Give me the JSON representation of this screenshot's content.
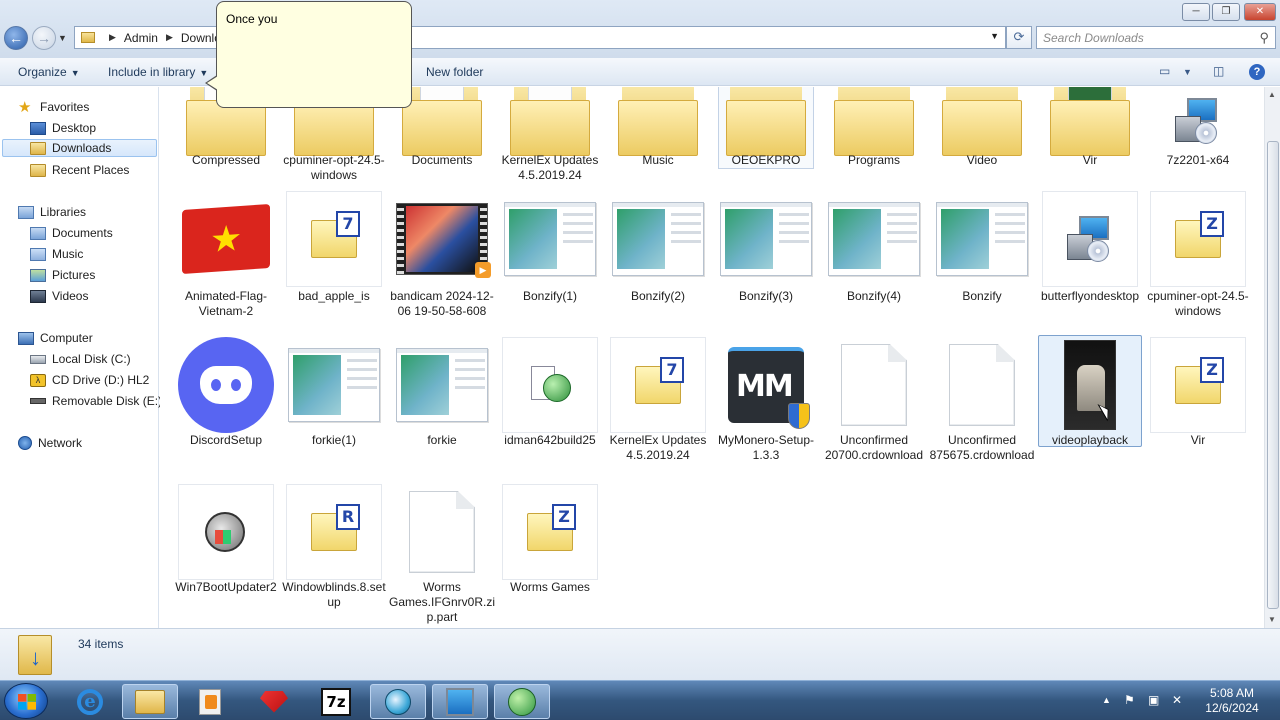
{
  "window": {
    "minimize_label": "─",
    "maximize_label": "❐",
    "close_label": "✕"
  },
  "address": {
    "segments": [
      "Admin",
      "Downloads"
    ],
    "search_placeholder": "Search Downloads"
  },
  "toolbar": {
    "organize": "Organize",
    "include_library": "Include in library",
    "new_folder": "New folder"
  },
  "callout": {
    "text": "Once you"
  },
  "nav": {
    "favorites": "Favorites",
    "desktop": "Desktop",
    "downloads": "Downloads",
    "recent": "Recent Places",
    "libraries": "Libraries",
    "documents": "Documents",
    "music": "Music",
    "pictures": "Pictures",
    "videos": "Videos",
    "computer": "Computer",
    "local_disk": "Local Disk (C:)",
    "cd_drive": "CD Drive (D:) HL2",
    "removable": "Removable Disk (E:)",
    "network": "Network"
  },
  "files": {
    "row1": [
      "Compressed",
      "cpuminer-opt-24.5-windows",
      "Documents",
      "KernelEx Updates 4.5.2019.24",
      "Music",
      "OEOEKPRO",
      "Programs",
      "Video",
      "Vir",
      "7z2201-x64"
    ],
    "row2": [
      "Animated-Flag-Vietnam-2",
      "bad_apple_is",
      "bandicam 2024-12-06 19-50-58-608",
      "Bonzify(1)",
      "Bonzify(2)",
      "Bonzify(3)",
      "Bonzify(4)",
      "Bonzify",
      "butterflyondesktop",
      "cpuminer-opt-24.5-windows"
    ],
    "row3": [
      "DiscordSetup",
      "forkie(1)",
      "forkie",
      "idman642build25",
      "KernelEx Updates 4.5.2019.24",
      "MyMonero-Setup-1.3.3",
      "Unconfirmed 20700.crdownload",
      "Unconfirmed 875675.crdownload",
      "videoplayback",
      "Vir"
    ],
    "row4": [
      "Win7BootUpdater2",
      "Windowblinds.8.setup",
      "Worms Games.IFGnrv0R.zip.part",
      "Worms Games"
    ]
  },
  "status": {
    "item_count": "34 items"
  },
  "taskbar": {
    "time": "5:08 AM",
    "date": "12/6/2024",
    "sevenzip_label": "7z",
    "ie_glyph": "e"
  },
  "icons": {
    "archive_7z": "7",
    "archive_z": "Z",
    "archive_r": "R",
    "mymonero": "MM"
  }
}
